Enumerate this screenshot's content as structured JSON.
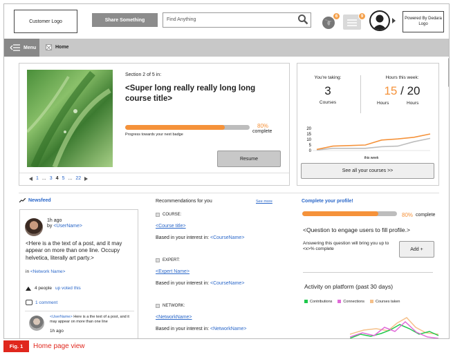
{
  "header": {
    "customer_logo": "Customer Logo",
    "share_button": "Share Something",
    "search_placeholder": "Find Anything",
    "notifications_count": "6",
    "messages_count": "9",
    "powered_by": "Powered By Dedara Logo"
  },
  "nav": {
    "menu_label": "Menu",
    "breadcrumb_home": "Home"
  },
  "course": {
    "section_label": "Section 2 of 5 in:",
    "title": "<Super long really really long long course title>",
    "progress_percent": 80,
    "progress_label": "80%",
    "complete_label": "complete",
    "progress_caption": "Progress towards your next badge",
    "resume_button": "Resume",
    "pager": {
      "first": "1",
      "ellipsis_1": "...",
      "p3": "3",
      "current": "4",
      "p5": "5",
      "ellipsis_2": "...",
      "last": "22"
    }
  },
  "stats": {
    "taking_label": "You're taking:",
    "courses_count": "3",
    "courses_label": "Courses",
    "hours_label": "Hours this week:",
    "hours_done": "15",
    "hours_slash": "/",
    "hours_goal": "20",
    "hours_unit_1": "Hours",
    "hours_unit_2": "Hours",
    "see_all_button": "See all your courses >>",
    "colors": {
      "orange": "#f5923a",
      "gray": "#bdbdbd"
    }
  },
  "chart_data": {
    "type": "line",
    "xlabel": "this week",
    "ylabel": "",
    "yticks": [
      "20",
      "15",
      "10",
      "5",
      "0"
    ],
    "ylim": [
      0,
      20
    ],
    "x": [
      1,
      2,
      3,
      4,
      5,
      6,
      7,
      8
    ],
    "series": [
      {
        "color": "#f5923a",
        "values": [
          1,
          4,
          4.5,
          5,
          9.5,
          10.5,
          12,
          15
        ]
      },
      {
        "color": "#bdbdbd",
        "values": [
          0.5,
          2,
          2,
          2,
          3.5,
          4,
          8,
          11
        ]
      }
    ]
  },
  "newsfeed": {
    "title": "Newsfeed",
    "post_time": "1h ago",
    "post_by_prefix": "by ",
    "post_user": "<UserName>",
    "post_text": "<Here is a the text of a post, and it may appear on more than one line. Occupy helvetica, literally art party.>",
    "post_in_prefix": "in ",
    "post_network": "<Network Name>",
    "votes_count": "4 people",
    "votes_link": "up voted this",
    "comments_link": "1 comment",
    "comment_user": "<UserName>",
    "comment_text": " Here is a the text of a post, and it may appear on more than one line",
    "comment_time": "1h ago"
  },
  "recommendations": {
    "title": "Recommendations for you",
    "see_more": "See more",
    "items": [
      {
        "type": "COURSE:",
        "name": "<Course title>",
        "based_prefix": "Based in your interest in: ",
        "based_link": "<CourseName>"
      },
      {
        "type": "EXPERT:",
        "name": "<Expert Name>",
        "based_prefix": "Based in your interest in: ",
        "based_link": "<CourseName>"
      },
      {
        "type": "NETWORK:",
        "name": "<NetworkName>",
        "based_prefix": "Based in your interest in: ",
        "based_link": "<NetworkName>"
      }
    ]
  },
  "profile": {
    "title": "Complete your profile!",
    "progress_percent": 80,
    "progress_label": "80%",
    "complete_label": "complete",
    "question": "<Question to engage users to fill profile.>",
    "desc": "Answering this question will bring you up to <x>% complete",
    "add_button": "Add +"
  },
  "activity": {
    "title": "Activity on platform (past 30 days)",
    "legend": [
      {
        "label": "Contributions",
        "color": "#1ec84b"
      },
      {
        "label": "Connections",
        "color": "#e06ad8"
      },
      {
        "label": "Courses taken",
        "color": "#f5c08a"
      }
    ]
  },
  "caption": {
    "fig_label": "Fig. 1",
    "title": "Home page view"
  }
}
